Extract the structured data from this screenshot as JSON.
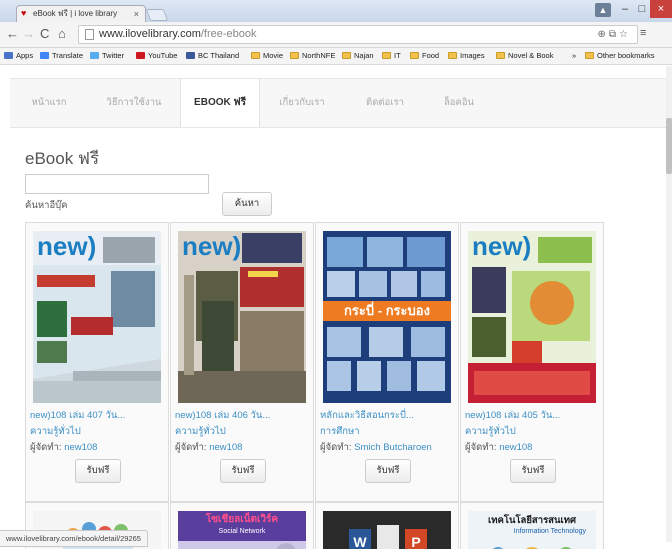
{
  "browser": {
    "tab_title": "eBook ฟรี | i love library",
    "tab_close": "×",
    "url_domain": "www.ilovelibrary.com",
    "url_path": "/free-ebook",
    "status_url": "www.ilovelibrary.com/ebook/detail/29265",
    "bookmarks": [
      "Apps",
      "Translate",
      "Twitter",
      "YouTube",
      "BC Thailand",
      "Movie",
      "NorthNFE",
      "Najan",
      "IT",
      "Food",
      "Images",
      "Novel & Book",
      "»",
      "Other bookmarks"
    ]
  },
  "site_nav": [
    "หน้าแรก",
    "วิธีการใช้งาน",
    "EBOOK ฟรี",
    "เกี่ยวกับเรา",
    "ติดต่อเรา",
    "ล็อคอิน"
  ],
  "page": {
    "title": "eBook ฟรี",
    "search_label": "ค้นหาอีบุ๊ค",
    "search_button": "ค้นหา"
  },
  "books": [
    {
      "title": "new)108 เล่ม 407 วัน...",
      "category": "ความรู้ทั่วไป",
      "producer_label": "ผู้จัดทำ:",
      "producer": "new108",
      "button": "รับฟรี"
    },
    {
      "title": "new)108 เล่ม 406 วัน...",
      "category": "ความรู้ทั่วไป",
      "producer_label": "ผู้จัดทำ:",
      "producer": "new108",
      "button": "รับฟรี"
    },
    {
      "title": "หลักและวิธีสอนกระบี่...",
      "category": "การศึกษา",
      "producer_label": "ผู้จัดทำ:",
      "producer": "Smich Butcharoen",
      "button": "รับฟรี"
    },
    {
      "title": "new)108 เล่ม 405 วัน...",
      "category": "ความรู้ทั่วไป",
      "producer_label": "ผู้จัดทำ:",
      "producer": "new108",
      "button": "รับฟรี"
    }
  ],
  "covers": {
    "brand": "new)",
    "cover3_text": "กระบี่ - กระบอง",
    "row2_2": "โซเชียลเน็ตเวิร์ค",
    "row2_2_sub": "Social Network",
    "row2_4": "เทคโนโลยีสารสนเทศ",
    "row2_4_sub": "Information Technology"
  }
}
